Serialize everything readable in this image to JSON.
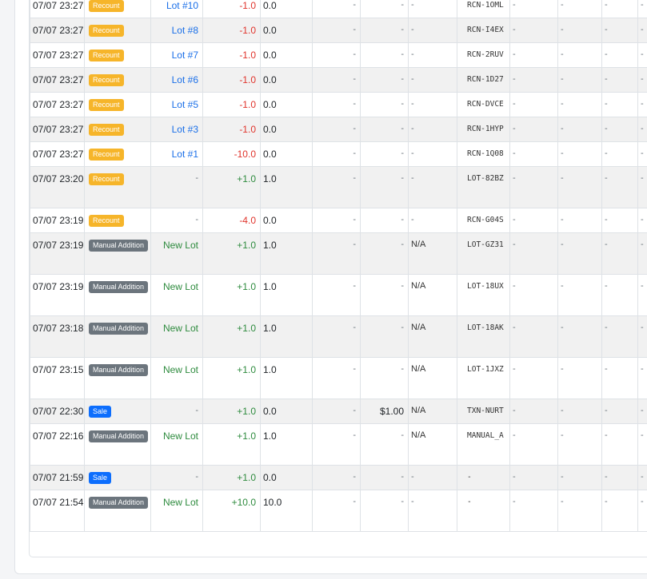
{
  "colors": {
    "recount": "#f6b52a",
    "manual": "#6c757d",
    "sale": "#0d6efd",
    "negative": "#e0342c",
    "positive": "#2e8b3e",
    "lot_link": "#1a6fe8"
  },
  "rows": [
    {
      "date": "07/07 23:27",
      "type": "Recount",
      "type_class": "recount",
      "lot": "Lot #10",
      "lot_style": "blue",
      "change": "-1.0",
      "change_sign": "neg",
      "qty": "0.0",
      "c4": "-",
      "price": "-",
      "c6": "-",
      "ref": "RCN-1OML",
      "c8": "-",
      "c9": "-",
      "c10": "-",
      "c11": "-",
      "h": 31
    },
    {
      "date": "07/07 23:27",
      "type": "Recount",
      "type_class": "recount",
      "lot": "Lot #8",
      "lot_style": "blue",
      "change": "-1.0",
      "change_sign": "neg",
      "qty": "0.0",
      "c4": "-",
      "price": "-",
      "c6": "-",
      "ref": "RCN-I4EX",
      "c8": "-",
      "c9": "-",
      "c10": "-",
      "c11": "-",
      "h": 31
    },
    {
      "date": "07/07 23:27",
      "type": "Recount",
      "type_class": "recount",
      "lot": "Lot #7",
      "lot_style": "blue",
      "change": "-1.0",
      "change_sign": "neg",
      "qty": "0.0",
      "c4": "-",
      "price": "-",
      "c6": "-",
      "ref": "RCN-2RUV",
      "c8": "-",
      "c9": "-",
      "c10": "-",
      "c11": "-",
      "h": 31
    },
    {
      "date": "07/07 23:27",
      "type": "Recount",
      "type_class": "recount",
      "lot": "Lot #6",
      "lot_style": "blue",
      "change": "-1.0",
      "change_sign": "neg",
      "qty": "0.0",
      "c4": "-",
      "price": "-",
      "c6": "-",
      "ref": "RCN-1D27",
      "c8": "-",
      "c9": "-",
      "c10": "-",
      "c11": "-",
      "h": 31
    },
    {
      "date": "07/07 23:27",
      "type": "Recount",
      "type_class": "recount",
      "lot": "Lot #5",
      "lot_style": "blue",
      "change": "-1.0",
      "change_sign": "neg",
      "qty": "0.0",
      "c4": "-",
      "price": "-",
      "c6": "-",
      "ref": "RCN-DVCE",
      "c8": "-",
      "c9": "-",
      "c10": "-",
      "c11": "-",
      "h": 31
    },
    {
      "date": "07/07 23:27",
      "type": "Recount",
      "type_class": "recount",
      "lot": "Lot #3",
      "lot_style": "blue",
      "change": "-1.0",
      "change_sign": "neg",
      "qty": "0.0",
      "c4": "-",
      "price": "-",
      "c6": "-",
      "ref": "RCN-1HYP",
      "c8": "-",
      "c9": "-",
      "c10": "-",
      "c11": "-",
      "h": 31
    },
    {
      "date": "07/07 23:27",
      "type": "Recount",
      "type_class": "recount",
      "lot": "Lot #1",
      "lot_style": "blue",
      "change": "-10.0",
      "change_sign": "neg",
      "qty": "0.0",
      "c4": "-",
      "price": "-",
      "c6": "-",
      "ref": "RCN-1Q08",
      "c8": "-",
      "c9": "-",
      "c10": "-",
      "c11": "-",
      "h": 31
    },
    {
      "date": "07/07 23:20",
      "type": "Recount",
      "type_class": "recount",
      "lot": "-",
      "lot_style": "dash",
      "change": "+1.0",
      "change_sign": "pos",
      "qty": "1.0",
      "c4": "-",
      "price": "-",
      "c6": "-",
      "ref": "LOT-82BZ",
      "c8": "-",
      "c9": "-",
      "c10": "-",
      "c11": "-",
      "h": 52
    },
    {
      "date": "07/07 23:19",
      "type": "Recount",
      "type_class": "recount",
      "lot": "-",
      "lot_style": "dash",
      "change": "-4.0",
      "change_sign": "neg",
      "qty": "0.0",
      "c4": "-",
      "price": "-",
      "c6": "-",
      "ref": "RCN-G04S",
      "c8": "-",
      "c9": "-",
      "c10": "-",
      "c11": "-",
      "h": 31
    },
    {
      "date": "07/07 23:19",
      "type": "Manual Addition",
      "type_class": "manual",
      "lot": "New Lot",
      "lot_style": "green",
      "change": "+1.0",
      "change_sign": "pos",
      "qty": "1.0",
      "c4": "-",
      "price": "-",
      "c6": "N/A",
      "ref": "LOT-GZ31",
      "c8": "-",
      "c9": "-",
      "c10": "-",
      "c11": "-",
      "h": 52
    },
    {
      "date": "07/07 23:19",
      "type": "Manual Addition",
      "type_class": "manual",
      "lot": "New Lot",
      "lot_style": "green",
      "change": "+1.0",
      "change_sign": "pos",
      "qty": "1.0",
      "c4": "-",
      "price": "-",
      "c6": "N/A",
      "ref": "LOT-18UX",
      "c8": "-",
      "c9": "-",
      "c10": "-",
      "c11": "-",
      "h": 52
    },
    {
      "date": "07/07 23:18",
      "type": "Manual Addition",
      "type_class": "manual",
      "lot": "New Lot",
      "lot_style": "green",
      "change": "+1.0",
      "change_sign": "pos",
      "qty": "1.0",
      "c4": "-",
      "price": "-",
      "c6": "N/A",
      "ref": "LOT-18AK",
      "c8": "-",
      "c9": "-",
      "c10": "-",
      "c11": "-",
      "h": 52
    },
    {
      "date": "07/07 23:15",
      "type": "Manual Addition",
      "type_class": "manual",
      "lot": "New Lot",
      "lot_style": "green",
      "change": "+1.0",
      "change_sign": "pos",
      "qty": "1.0",
      "c4": "-",
      "price": "-",
      "c6": "N/A",
      "ref": "LOT-1JXZ",
      "c8": "-",
      "c9": "-",
      "c10": "-",
      "c11": "-",
      "h": 52
    },
    {
      "date": "07/07 22:30",
      "type": "Sale",
      "type_class": "sale",
      "lot": "-",
      "lot_style": "dash",
      "change": "+1.0",
      "change_sign": "pos",
      "qty": "0.0",
      "c4": "-",
      "price": "$1.00",
      "c6": "N/A",
      "ref": "TXN-NURT",
      "c8": "-",
      "c9": "-",
      "c10": "-",
      "c11": "-",
      "h": 31
    },
    {
      "date": "07/07 22:16",
      "type": "Manual Addition",
      "type_class": "manual",
      "lot": "New Lot",
      "lot_style": "green",
      "change": "+1.0",
      "change_sign": "pos",
      "qty": "1.0",
      "c4": "-",
      "price": "-",
      "c6": "N/A",
      "ref": "MANUAL_A",
      "c8": "-",
      "c9": "-",
      "c10": "-",
      "c11": "-",
      "h": 52
    },
    {
      "date": "07/07 21:59",
      "type": "Sale",
      "type_class": "sale",
      "lot": "-",
      "lot_style": "dash",
      "change": "+1.0",
      "change_sign": "pos",
      "qty": "0.0",
      "c4": "-",
      "price": "-",
      "c6": "-",
      "ref": "-",
      "c8": "-",
      "c9": "-",
      "c10": "-",
      "c11": "-",
      "h": 31
    },
    {
      "date": "07/07 21:54",
      "type": "Manual Addition",
      "type_class": "manual",
      "lot": "New Lot",
      "lot_style": "green",
      "change": "+10.0",
      "change_sign": "pos",
      "qty": "10.0",
      "c4": "-",
      "price": "-",
      "c6": "-",
      "ref": "-",
      "c8": "-",
      "c9": "-",
      "c10": "-",
      "c11": "-",
      "h": 52
    }
  ]
}
